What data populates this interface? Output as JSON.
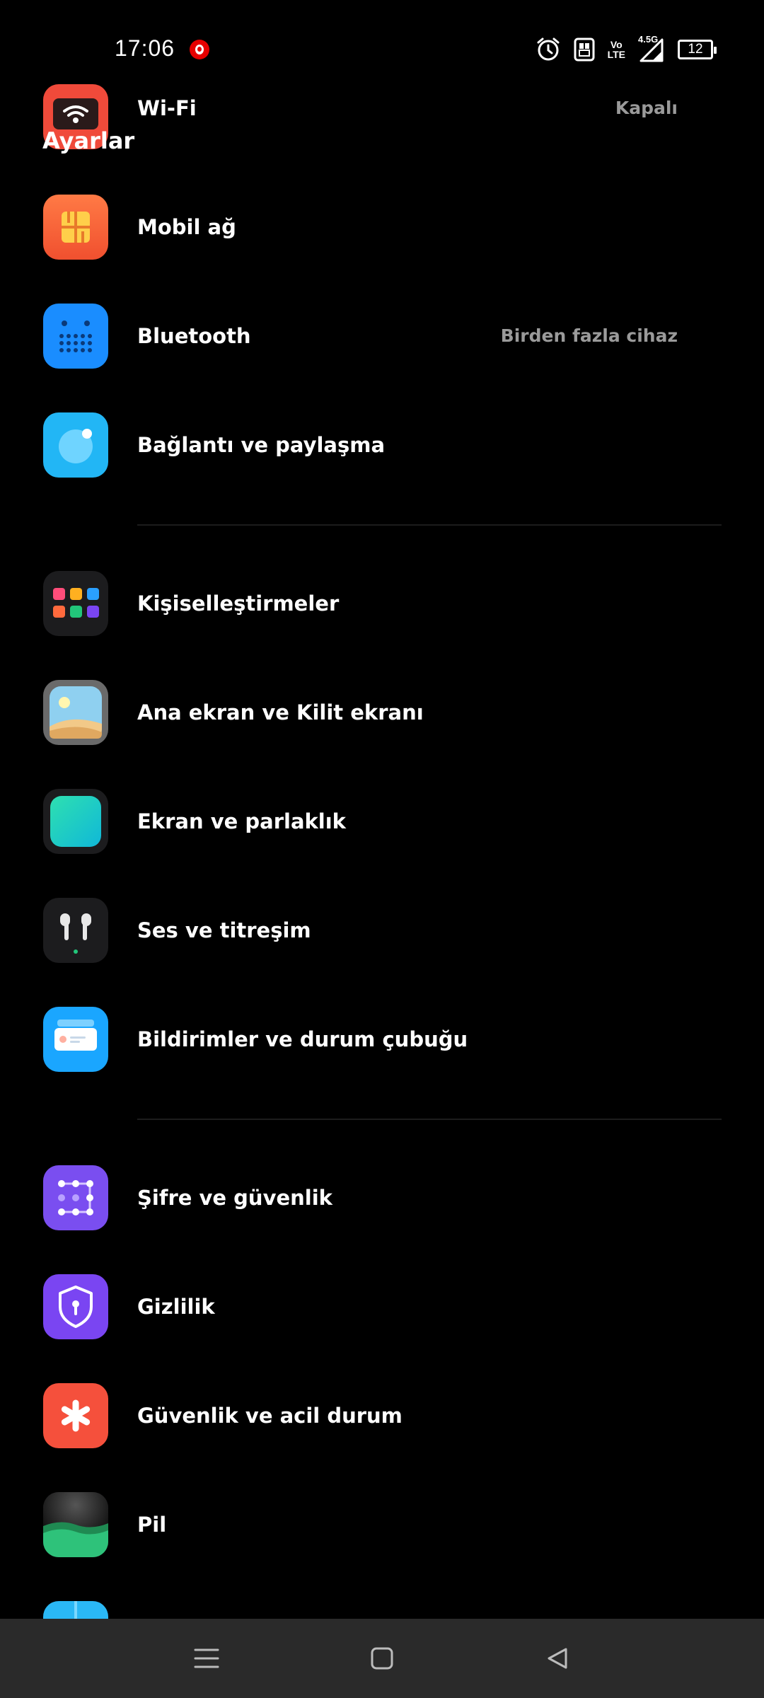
{
  "status_bar": {
    "time": "17:06",
    "network_label": "4.5G",
    "volte_top": "Vo",
    "volte_bottom": "LTE",
    "battery": "12"
  },
  "page": {
    "title": "Ayarlar"
  },
  "settings": {
    "wifi": {
      "label": "Wi-Fi",
      "value": "Kapalı",
      "icon": "wifi-icon"
    },
    "mobile": {
      "label": "Mobil ağ",
      "icon": "sim-card-icon"
    },
    "bluetooth": {
      "label": "Bluetooth",
      "value": "Birden fazla cihaz",
      "icon": "bluetooth-icon"
    },
    "connection": {
      "label": "Bağlantı ve paylaşma",
      "icon": "connection-icon"
    },
    "personalize": {
      "label": "Kişiselleştirmeler",
      "icon": "apps-grid-icon"
    },
    "homescreen": {
      "label": "Ana ekran ve Kilit ekranı",
      "icon": "wallpaper-icon"
    },
    "display": {
      "label": "Ekran ve parlaklık",
      "icon": "display-icon"
    },
    "sound": {
      "label": "Ses ve titreşim",
      "icon": "earbuds-icon"
    },
    "notifications": {
      "label": "Bildirimler ve durum çubuğu",
      "icon": "notification-icon"
    },
    "password": {
      "label": "Şifre ve güvenlik",
      "icon": "pattern-lock-icon"
    },
    "privacy": {
      "label": "Gizlilik",
      "icon": "privacy-shield-icon"
    },
    "emergency": {
      "label": "Güvenlik ve acil durum",
      "icon": "emergency-icon"
    },
    "battery": {
      "label": "Pil",
      "icon": "battery-wave-icon"
    }
  },
  "colors": {
    "wifi": "#f04a3a",
    "mobile": "#ff6a3d",
    "bluetooth": "#1a8dff",
    "connection": "#22b6f5",
    "privacy": "#7a45f2",
    "emergency": "#f5503c"
  }
}
